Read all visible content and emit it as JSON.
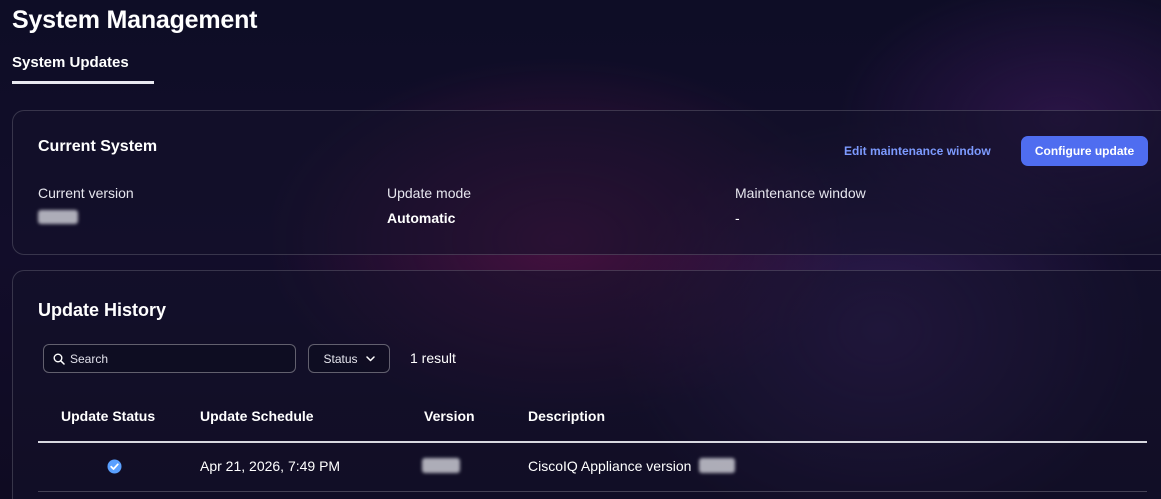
{
  "page": {
    "title": "System Management"
  },
  "tabs": [
    {
      "label": "System Updates",
      "active": true
    }
  ],
  "current_system": {
    "heading": "Current System",
    "edit_link": "Edit maintenance window",
    "configure_button": "Configure update",
    "fields": [
      {
        "label": "Current version",
        "value": ""
      },
      {
        "label": "Update mode",
        "value": "Automatic"
      },
      {
        "label": "Maintenance window",
        "value": "-"
      }
    ]
  },
  "update_history": {
    "heading": "Update History",
    "search": {
      "placeholder": "Search",
      "value": ""
    },
    "status_filter": {
      "label": "Status"
    },
    "result_count": "1 result",
    "columns": [
      "Update Status",
      "Update Schedule",
      "Version",
      "Description"
    ],
    "rows": [
      {
        "status": "success",
        "schedule": "Apr 21, 2026, 7:49 PM",
        "version": "",
        "description": "CiscoIQ Appliance version"
      }
    ]
  },
  "colors": {
    "accent": "#4f6df0",
    "link": "#7d9bff",
    "success": "#5aa0ff"
  }
}
